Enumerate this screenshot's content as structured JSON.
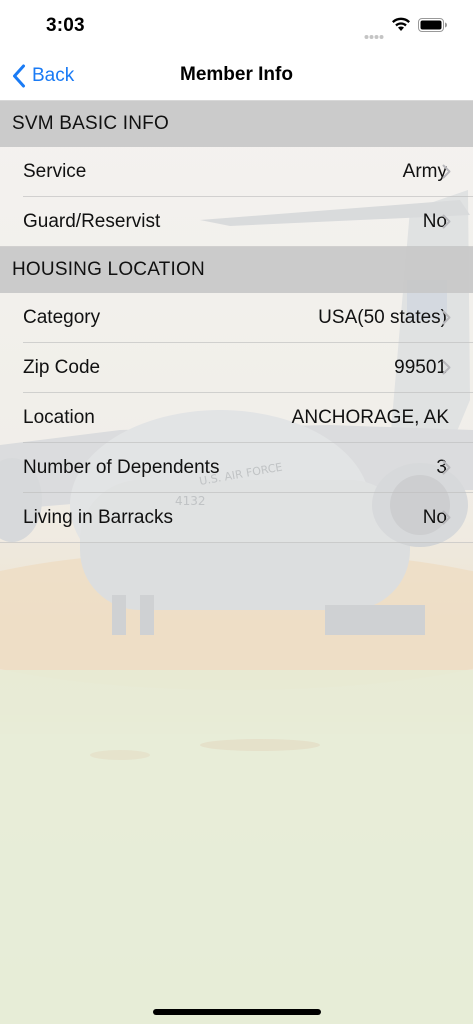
{
  "status_bar": {
    "time": "3:03"
  },
  "nav": {
    "back_label": "Back",
    "title": "Member Info"
  },
  "sections": [
    {
      "header": "SVM BASIC INFO",
      "rows": [
        {
          "label": "Service",
          "value": "Army",
          "chevron": true
        },
        {
          "label": "Guard/Reservist",
          "value": "No",
          "chevron": true
        }
      ]
    },
    {
      "header": "HOUSING LOCATION",
      "rows": [
        {
          "label": "Category",
          "value": "USA(50 states)",
          "chevron": true
        },
        {
          "label": "Zip Code",
          "value": "99501",
          "chevron": true
        },
        {
          "label": "Location",
          "value": "ANCHORAGE, AK",
          "chevron": false
        },
        {
          "label": "Number of Dependents",
          "value": "3",
          "chevron": true
        },
        {
          "label": "Living in Barracks",
          "value": "No",
          "chevron": true
        }
      ]
    }
  ],
  "background": {
    "aircraft_markings": "U.S. AIR FORCE",
    "tail_number": "4132"
  },
  "colors": {
    "accent": "#1a7bf5",
    "section_header_bg": "#c8c8c8",
    "chevron": "#b8b8bc"
  }
}
